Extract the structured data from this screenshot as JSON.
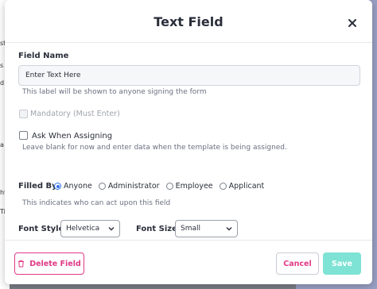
{
  "background": {
    "fragments": [
      "st",
      "s",
      "d",
      "a",
      "ht",
      "Tir"
    ]
  },
  "modal": {
    "title": "Text Field",
    "close_icon": "close-icon"
  },
  "field_name": {
    "label": "Field Name",
    "value": "Enter Text Here",
    "hint": "This label will be shown to anyone signing the form"
  },
  "mandatory": {
    "label": "Mandatory (Must Enter)",
    "checked": false,
    "disabled": true
  },
  "ask_when_assigning": {
    "label": "Ask When Assigning",
    "checked": false,
    "hint": "Leave blank for now and enter data when the template is being assigned."
  },
  "filled_by": {
    "label": "Filled By",
    "options": [
      "Anyone",
      "Administrator",
      "Employee",
      "Applicant"
    ],
    "selected": "Anyone",
    "hint": "This indicates who can act upon this field"
  },
  "font_style": {
    "label": "Font Style",
    "value": "Helvetica"
  },
  "font_size": {
    "label": "Font Size",
    "value": "Small"
  },
  "footer": {
    "delete_label": "Delete Field",
    "cancel_label": "Cancel",
    "save_label": "Save"
  },
  "colors": {
    "accent_pink": "#e03a86",
    "save_teal": "#7ee3d4",
    "radio_blue": "#2f6fe8"
  }
}
